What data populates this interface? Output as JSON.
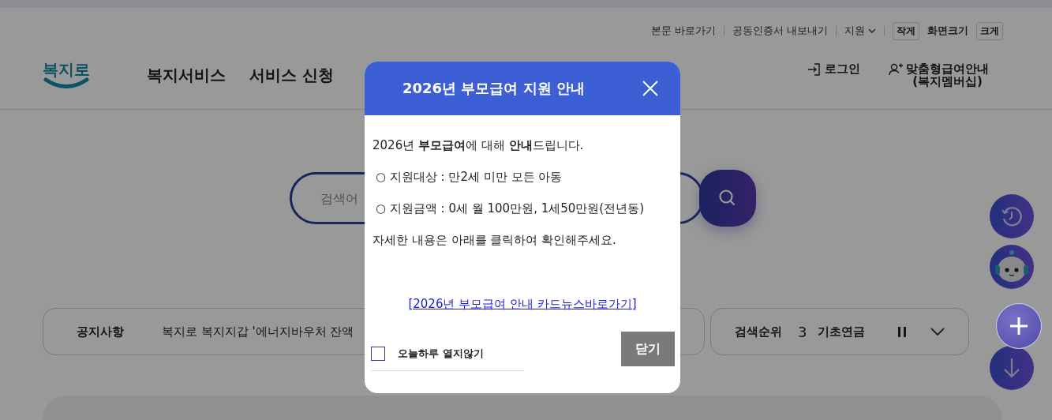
{
  "utility_links": [
    {
      "label": "본문 바로가기",
      "kind": "link"
    },
    {
      "label": "공동인증서 내보내기",
      "kind": "link"
    },
    {
      "label": "지원",
      "kind": "dropdown"
    }
  ],
  "font_size": {
    "smaller": "작게",
    "label": "화면크기",
    "larger": "크게"
  },
  "logo": {
    "text": "복지로"
  },
  "nav": [
    "복지서비스",
    "서비스 신청"
  ],
  "account": [
    {
      "label": "로그인",
      "kind": "login"
    },
    {
      "label": "맞춤형급여안내\n(복지멤버십)",
      "kind": "member"
    }
  ],
  "search": {
    "placeholder": "검색어"
  },
  "notice": {
    "label": "공지사항",
    "text": "복지로 복지지갑 '에너지바우처 잔액"
  },
  "ranking": {
    "label": "검색순위",
    "rank": "3",
    "keyword": "기초연금"
  },
  "floating_buttons": [
    {
      "kind": "history"
    },
    {
      "kind": "chatbot"
    },
    {
      "kind": "covered"
    },
    {
      "kind": "down"
    }
  ],
  "modal": {
    "title": "2026년 부모급여 지원 안내",
    "intro": "2026년 **부모급여**에 대해 **안내**드립니다.",
    "items": [
      "○ 지원대상 : 만2세 미만 모든 아동",
      "○ 지원금액 : 0세 월 100만원, 1세50만원(전년동)"
    ],
    "note": "자세한 내용은 아래를 클릭하여 확인해주세요.",
    "link": "[2026년 부모급여 안내 카드뉴스바로가기]",
    "dont_show": {
      "label": "오늘하루 열지않기",
      "checked": false
    },
    "close": "닫기"
  }
}
